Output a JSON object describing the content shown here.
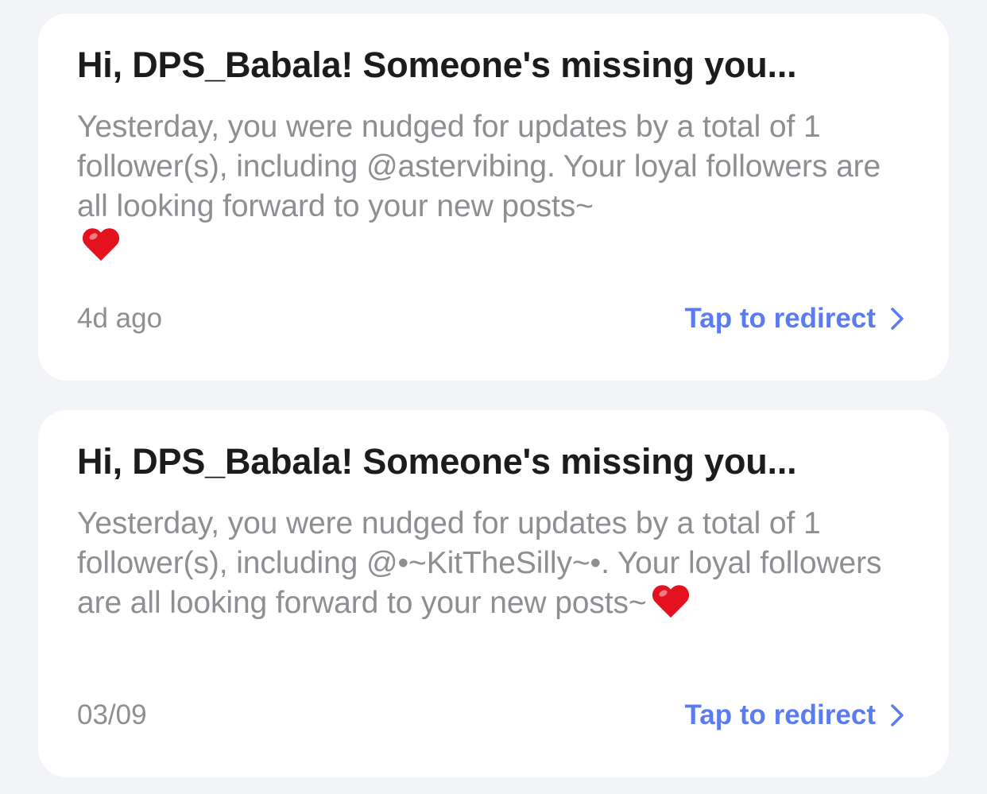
{
  "notifications": [
    {
      "title": "Hi, DPS_Babala! Someone's missing you...",
      "body": "Yesterday, you were nudged for updates by a total of 1 follower(s), including @astervibing. Your loyal followers are all looking forward to your new posts~",
      "emoji": "red-heart-icon",
      "time": "4d ago",
      "link_label": "Tap to redirect"
    },
    {
      "title": "Hi, DPS_Babala! Someone's missing you...",
      "body": "Yesterday, you were nudged for updates by a total of 1 follower(s), including @•~KitTheSilly~•. Your loyal followers are all looking forward to your new posts~",
      "emoji": "red-heart-icon",
      "time": "03/09",
      "link_label": "Tap to redirect"
    }
  ],
  "colors": {
    "background": "#f3f4f8",
    "card": "#ffffff",
    "title": "#1c1c1e",
    "body": "#8e8e93",
    "link": "#5b7cf0",
    "heart": "#e3121e"
  }
}
